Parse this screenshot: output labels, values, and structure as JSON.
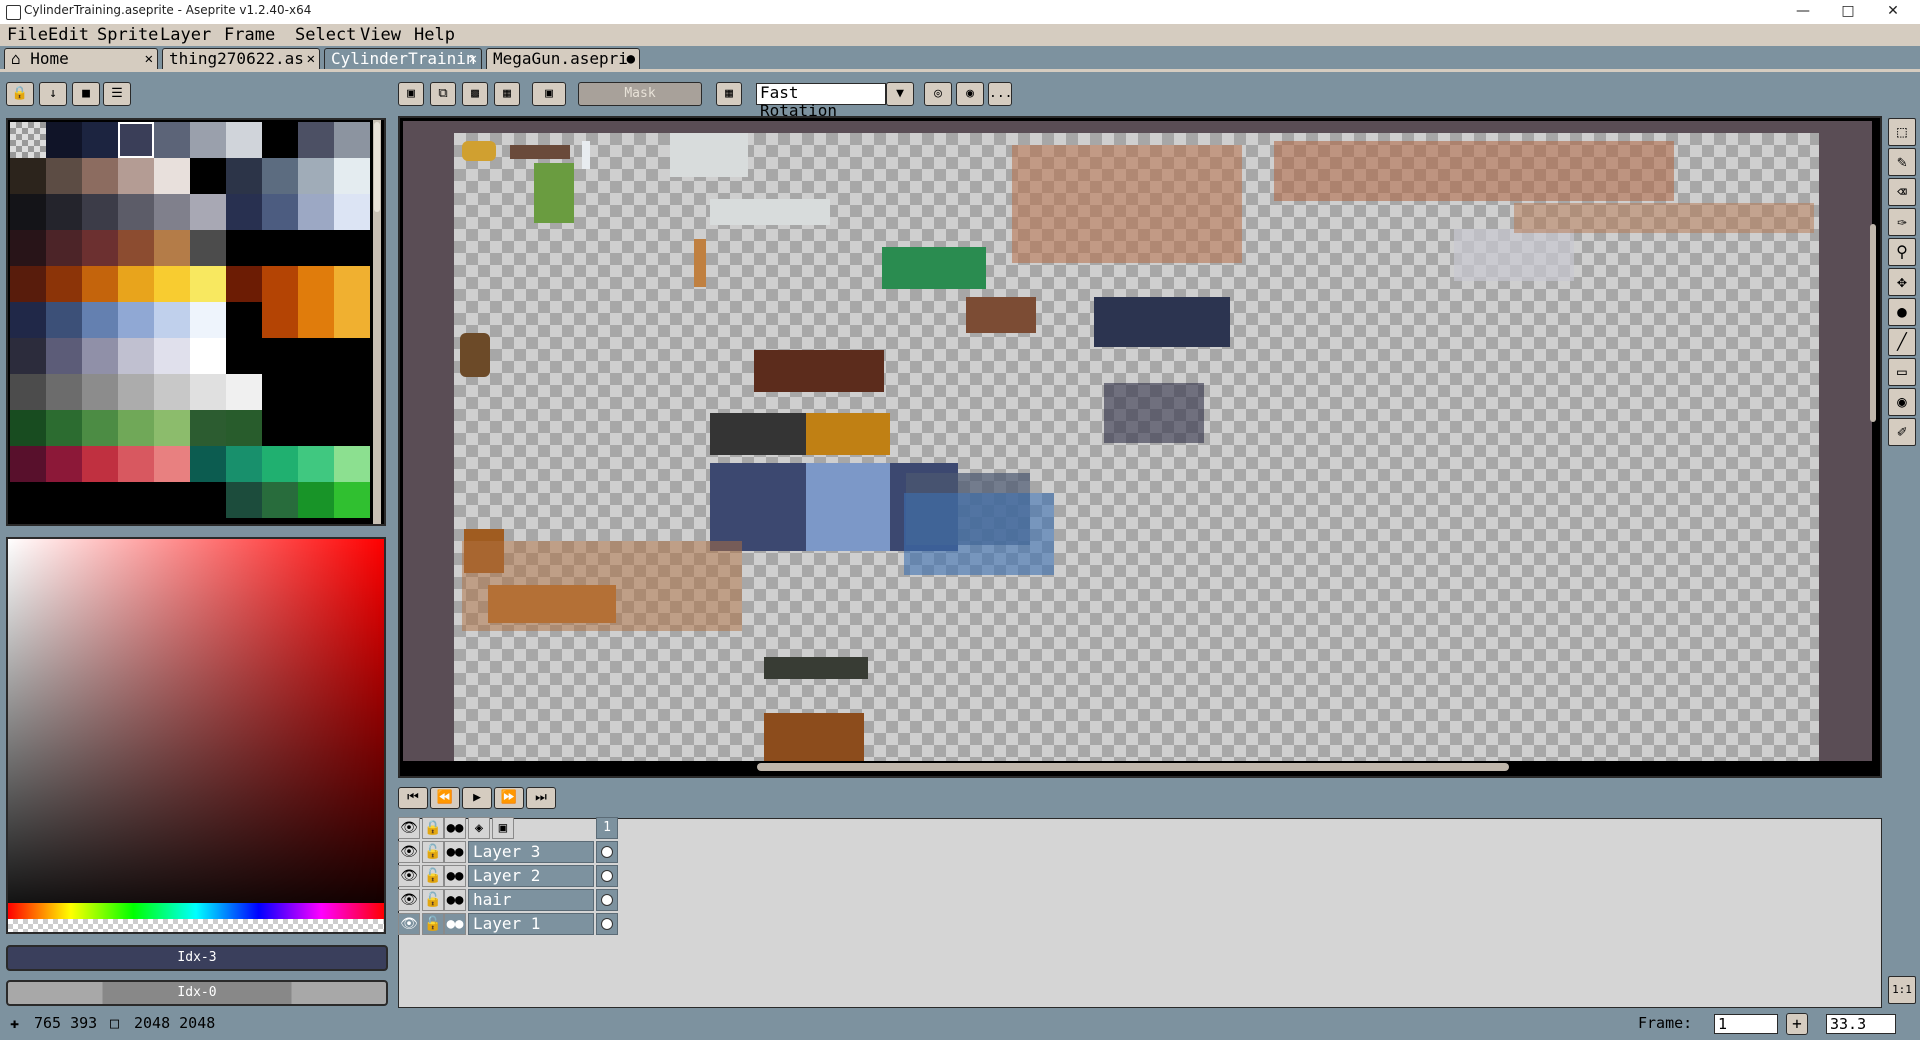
{
  "window": {
    "title": "CylinderTraining.aseprite - Aseprite v1.2.40-x64",
    "controls": [
      "—",
      "□",
      "✕"
    ]
  },
  "menu": [
    "File",
    "Edit",
    "Sprite",
    "Layer",
    "Frame",
    "Select",
    "View",
    "Help"
  ],
  "tabs": [
    {
      "label": "Home",
      "close": "✕"
    },
    {
      "label": "thing270622.as",
      "close": "✕"
    },
    {
      "label": "CylinderTrainin",
      "close": "✕"
    },
    {
      "label": "MegaGun.asepri",
      "close": "●"
    }
  ],
  "toolbar": {
    "mask_label": "Mask",
    "rotation_algorithm": "Fast Rotation",
    "more_label": "..."
  },
  "palette": {
    "colors": [
      "#c8c8c8",
      "#101428",
      "#1c2440",
      "#3a3e58",
      "#5c6478",
      "#9aa0ac",
      "#d0d4da",
      "#000000",
      "#4c5064",
      "#8c94a0",
      "#2c241c",
      "#5c4c44",
      "#8c6c60",
      "#b49c94",
      "#e8e0dc",
      "#000000",
      "#2c3448",
      "#5c6c80",
      "#a0acb8",
      "#e4ecf0",
      "#141418",
      "#24242c",
      "#3c3c48",
      "#5c5c68",
      "#80808c",
      "#a8a8b4",
      "#283050",
      "#4c5c80",
      "#9ca8c4",
      "#dce4f4",
      "#281418",
      "#4c2428",
      "#6c3030",
      "#8c4c30",
      "#b47c48",
      "#4c4c4c",
      "#000000",
      "#000000",
      "#000000",
      "#000000",
      "#581c0c",
      "#8c3408",
      "#c4640c",
      "#e8a41c",
      "#f8cc30",
      "#f8e860",
      "#6c1c04",
      "#b44404",
      "#e07c0c",
      "#f0b030",
      "#202848",
      "#3c5078",
      "#6480b0",
      "#90a8d4",
      "#c0d0ec",
      "#eef4fc",
      "#000000",
      "#b44404",
      "#e07c0c",
      "#f0b030",
      "#2c2c3c",
      "#5c5c78",
      "#9090a8",
      "#c0c0d0",
      "#e0e0ec",
      "#ffffff",
      "#000000",
      "#000000",
      "#000000",
      "#000000",
      "#4c4c4c",
      "#6c6c6c",
      "#8c8c8c",
      "#acacac",
      "#c8c8c8",
      "#e0e0e0",
      "#f0f0f0",
      "#000000",
      "#000000",
      "#000000",
      "#184c20",
      "#2c6c30",
      "#4c8c44",
      "#70a858",
      "#8cbc6c",
      "#2c5c30",
      "#285c2c",
      "#000000",
      "#000000",
      "#000000",
      "#58102c",
      "#8c1838",
      "#c03040",
      "#d85860",
      "#e88080",
      "#0c5c50",
      "#18906c",
      "#20b070",
      "#40c880",
      "#8ce090",
      "#000000",
      "#000000",
      "#000000",
      "#000000",
      "#000000",
      "#000000",
      "#1c4c3c",
      "#286c3c",
      "#189428",
      "#30c030"
    ]
  },
  "color_fields": {
    "fg_label": "Idx-3",
    "bg_label": "Idx-0"
  },
  "timeline": {
    "frame_header": "1",
    "layers": [
      {
        "name": "Layer 3"
      },
      {
        "name": "Layer 2"
      },
      {
        "name": "hair"
      },
      {
        "name": "Layer 1"
      }
    ]
  },
  "status": {
    "cursor_label": "765 393",
    "size_label": "2048 2048",
    "frame_label": "Frame:",
    "frame_value": "1",
    "zoom_value": "33.3"
  }
}
